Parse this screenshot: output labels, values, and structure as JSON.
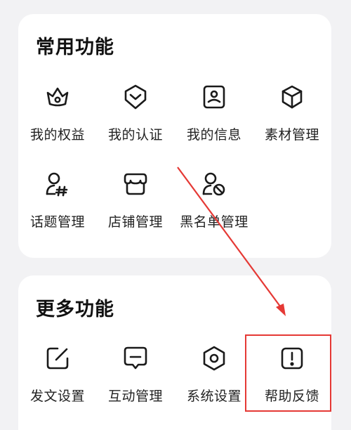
{
  "sections": [
    {
      "title": "常用功能",
      "items": [
        {
          "label": "我的权益",
          "icon": "crown-icon"
        },
        {
          "label": "我的认证",
          "icon": "badge-check-icon"
        },
        {
          "label": "我的信息",
          "icon": "id-card-icon"
        },
        {
          "label": "素材管理",
          "icon": "cube-icon"
        },
        {
          "label": "话题管理",
          "icon": "user-hashtag-icon"
        },
        {
          "label": "店铺管理",
          "icon": "store-icon"
        },
        {
          "label": "黑名单管理",
          "icon": "user-block-icon"
        }
      ]
    },
    {
      "title": "更多功能",
      "items": [
        {
          "label": "发文设置",
          "icon": "edit-icon"
        },
        {
          "label": "互动管理",
          "icon": "message-icon"
        },
        {
          "label": "系统设置",
          "icon": "settings-hexagon-icon"
        },
        {
          "label": "帮助反馈",
          "icon": "alert-square-icon"
        }
      ]
    }
  ],
  "annotation": {
    "color": "#e53935"
  }
}
